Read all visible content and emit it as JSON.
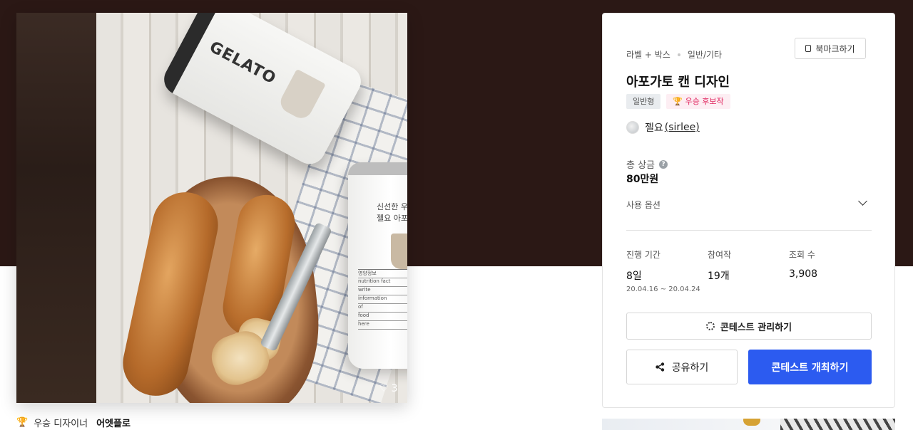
{
  "hero": {
    "like_count": "3",
    "can_brand": "GELATO",
    "can_text_line1": "신선한 우",
    "can_text_line2": "젤요 아포",
    "nutrition_title": "영양정보",
    "nutrition_rows": [
      "nutrition fact",
      "write",
      "information",
      "of",
      "food",
      "here"
    ]
  },
  "caption": {
    "label": "우승 디자이너",
    "designer": "어엣플로"
  },
  "card": {
    "category": "라벨 + 박스",
    "subcategory": "일반/기타",
    "bookmark_label": "북마크하기",
    "title": "아포가토 캔 디자인",
    "badge_type": "일반형",
    "badge_award": "🏆 우승 후보작",
    "author_name": "젤요",
    "author_id": "(sirlee)",
    "prize_label": "총 상금",
    "prize_value": "80만원",
    "usage_label": "사용 옵션",
    "stats": {
      "period_label": "진행 기간",
      "period_value": "8일",
      "period_range": "20.04.16  ~  20.04.24",
      "entries_label": "참여작",
      "entries_value": "19개",
      "views_label": "조회 수",
      "views_value": "3,908"
    },
    "manage_label": "콘테스트 관리하기",
    "share_label": "공유하기",
    "host_label": "콘테스트 개최하기"
  },
  "colors": {
    "banner": "#2b1815",
    "primary": "#2c5bf0",
    "award_text": "#e0245e"
  }
}
